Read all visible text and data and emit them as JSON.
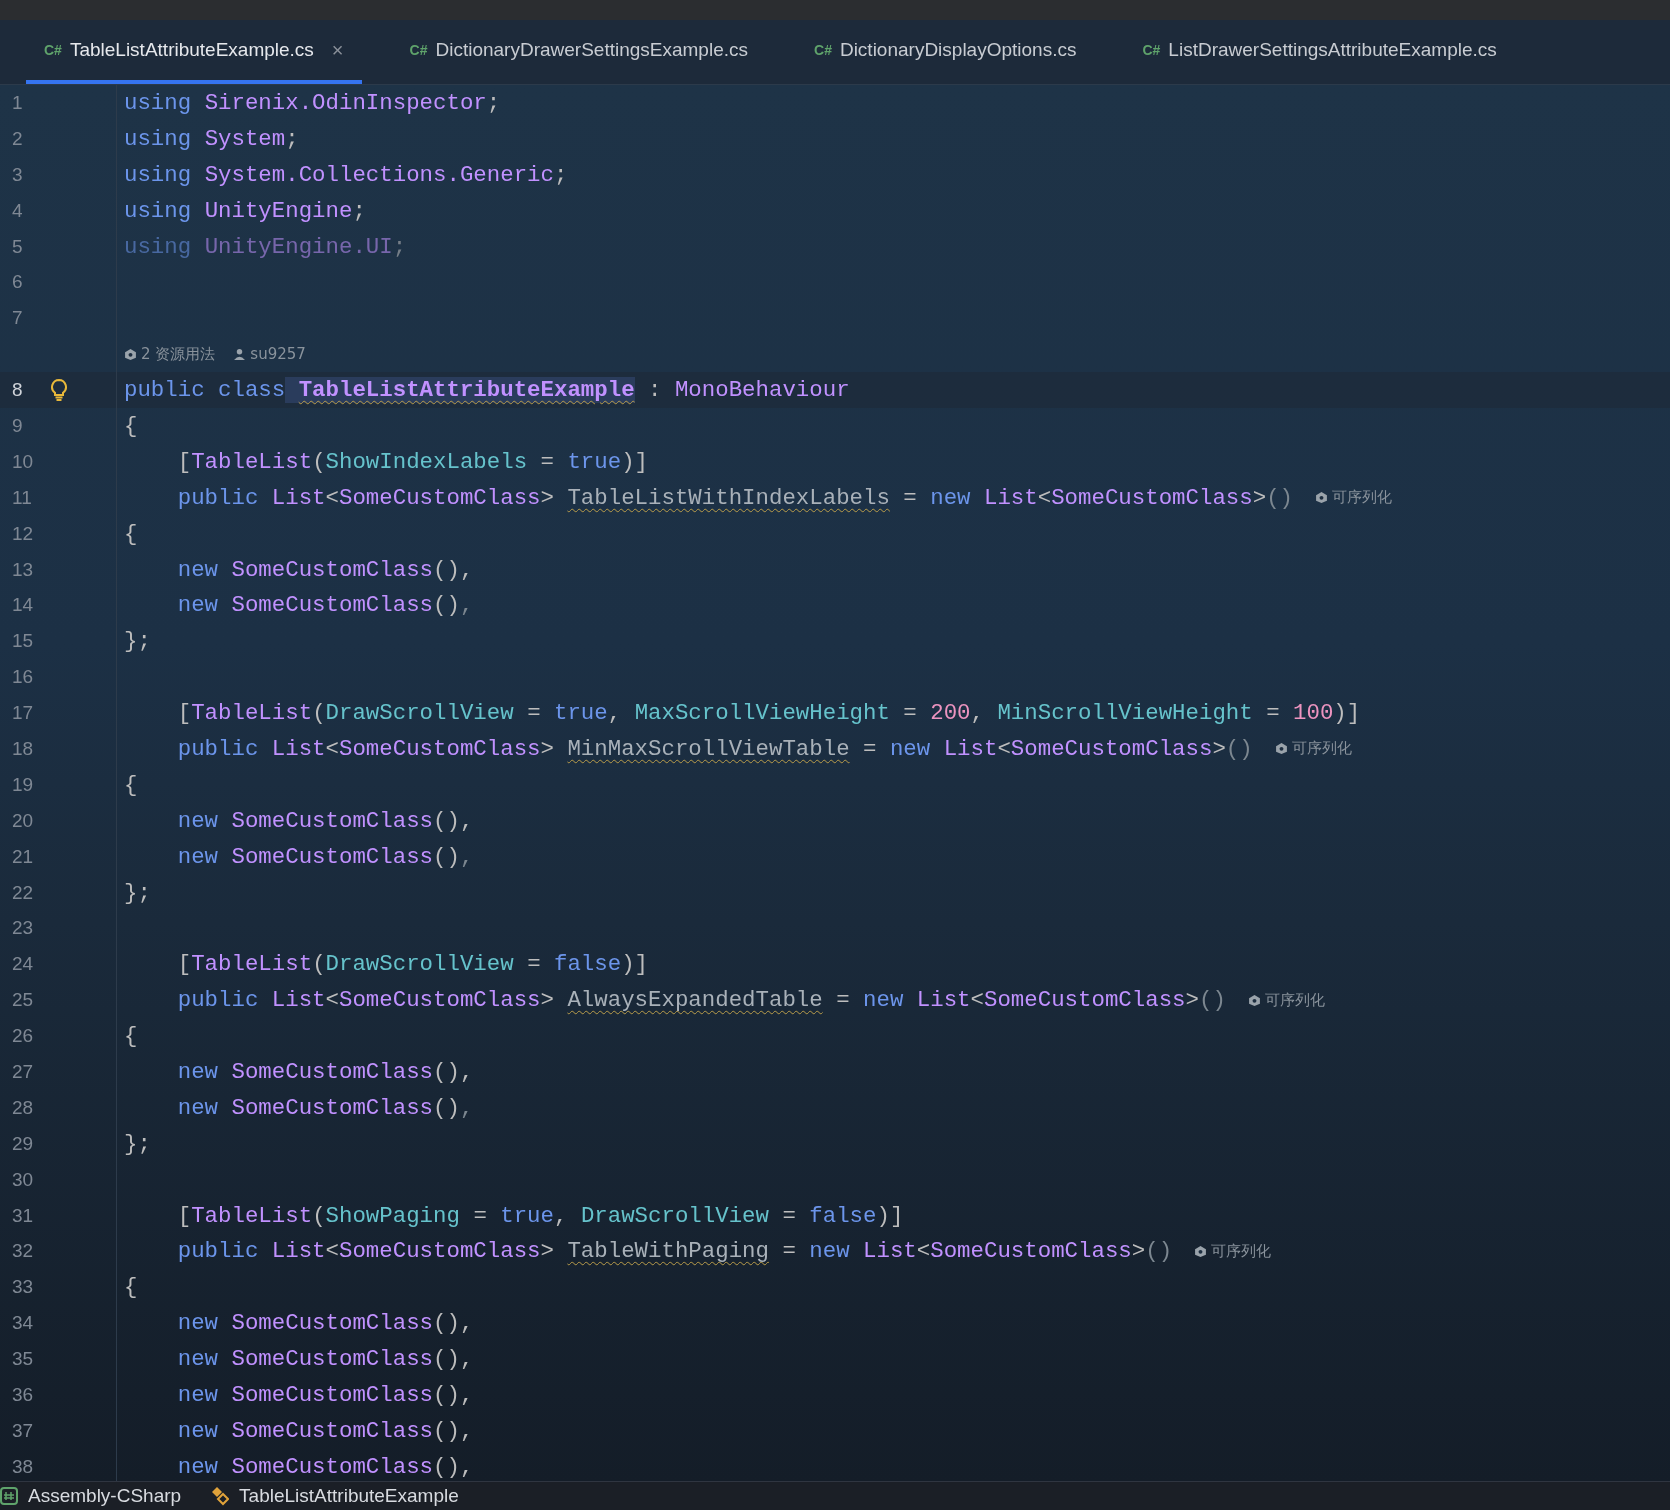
{
  "tabs": [
    {
      "icon": "C#",
      "label": "TableListAttributeExample.cs",
      "selected": true,
      "close": "×"
    },
    {
      "icon": "C#",
      "label": "DictionaryDrawerSettingsExample.cs",
      "selected": false
    },
    {
      "icon": "C#",
      "label": "DictionaryDisplayOptions.cs",
      "selected": false
    },
    {
      "icon": "C#",
      "label": "ListDrawerSettingsAttributeExample.cs",
      "selected": false
    }
  ],
  "lines": [
    {
      "number": "1",
      "current": false,
      "dim": false,
      "indented": false,
      "tokens": [
        {
          "kind": "kw",
          "text": "using",
          "space_before": false
        },
        {
          "kind": "ns",
          "text": "Sirenix.OdinInspector",
          "space_before": true
        },
        {
          "kind": "punct",
          "text": ";",
          "space_before": false
        }
      ]
    },
    {
      "number": "2",
      "current": false,
      "dim": false,
      "indented": false,
      "tokens": [
        {
          "kind": "kw",
          "text": "using",
          "space_before": false
        },
        {
          "kind": "ns",
          "text": "System",
          "space_before": true
        },
        {
          "kind": "punct",
          "text": ";",
          "space_before": false
        }
      ]
    },
    {
      "number": "3",
      "current": false,
      "dim": false,
      "indented": false,
      "tokens": [
        {
          "kind": "kw",
          "text": "using",
          "space_before": false
        },
        {
          "kind": "ns",
          "text": "System.Collections.Generic",
          "space_before": true
        },
        {
          "kind": "punct",
          "text": ";",
          "space_before": false
        }
      ]
    },
    {
      "number": "4",
      "current": false,
      "dim": false,
      "indented": false,
      "tokens": [
        {
          "kind": "kw",
          "text": "using",
          "space_before": false
        },
        {
          "kind": "ns",
          "text": "UnityEngine",
          "space_before": true
        },
        {
          "kind": "punct",
          "text": ";",
          "space_before": false
        }
      ]
    },
    {
      "number": "5",
      "current": false,
      "dim": true,
      "indented": false,
      "tokens": [
        {
          "kind": "kw",
          "text": "using",
          "space_before": false
        },
        {
          "kind": "ns",
          "text": "UnityEngine.UI",
          "space_before": true
        },
        {
          "kind": "punct",
          "text": ";",
          "space_before": false
        }
      ]
    },
    {
      "number": "6",
      "current": false
    },
    {
      "number": "7",
      "current": false
    },
    {
      "number": "8",
      "current": true,
      "dim": false,
      "indented": false,
      "lens": {
        "usages": "2 资源用法",
        "author": "su9257"
      },
      "tokens": [
        {
          "kind": "kw",
          "text": "public",
          "space_before": false
        },
        {
          "kind": "kw",
          "text": "class",
          "space_before": true
        },
        {
          "kind": "decl",
          "text": "TableListAttributeExample",
          "space_before": true
        },
        {
          "kind": "punct",
          "text": ":",
          "space_before": true
        },
        {
          "kind": "type",
          "text": "MonoBehaviour",
          "space_before": true
        }
      ]
    },
    {
      "number": "9",
      "current": false,
      "dim": false,
      "indented": false,
      "tokens": [
        {
          "kind": "punct",
          "text": "{",
          "space_before": false
        }
      ]
    },
    {
      "number": "10",
      "current": false,
      "dim": false,
      "indented": true,
      "tokens": [
        {
          "kind": "punct",
          "text": "[",
          "space_before": false
        },
        {
          "kind": "type",
          "text": "TableList",
          "space_before": false
        },
        {
          "kind": "punct",
          "text": "(",
          "space_before": false
        },
        {
          "kind": "prop",
          "text": "ShowIndexLabels",
          "space_before": false
        },
        {
          "kind": "punct",
          "text": "=",
          "space_before": true
        },
        {
          "kind": "kw",
          "text": "true",
          "space_before": true
        },
        {
          "kind": "punct",
          "text": ")]",
          "space_before": false
        }
      ]
    },
    {
      "number": "11",
      "current": false,
      "dim": false,
      "indented": true,
      "tokens": [
        {
          "kind": "kw",
          "text": "public",
          "space_before": false
        },
        {
          "kind": "type",
          "text": "List",
          "space_before": true
        },
        {
          "kind": "punct",
          "text": "<",
          "space_before": false
        },
        {
          "kind": "type",
          "text": "SomeCustomClass",
          "space_before": false
        },
        {
          "kind": "punct",
          "text": ">",
          "space_before": false
        },
        {
          "kind": "field",
          "text": "TableListWithIndexLabels",
          "space_before": true
        },
        {
          "kind": "punct",
          "text": "=",
          "space_before": true
        },
        {
          "kind": "kw",
          "text": "new",
          "space_before": true
        },
        {
          "kind": "type",
          "text": "List",
          "space_before": true
        },
        {
          "kind": "punct",
          "text": "<",
          "space_before": false
        },
        {
          "kind": "type",
          "text": "SomeCustomClass",
          "space_before": false
        },
        {
          "kind": "punct",
          "text": ">",
          "space_before": false
        },
        {
          "kind": "dim",
          "text": "()",
          "space_before": false
        },
        {
          "kind": "hint",
          "text": "可序列化",
          "space_before": true
        }
      ]
    },
    {
      "number": "12",
      "current": false,
      "dim": false,
      "indented": false,
      "tokens": [
        {
          "kind": "punct",
          "text": "{",
          "space_before": false
        }
      ]
    },
    {
      "number": "13",
      "current": false,
      "dim": false,
      "indented": true,
      "tokens": [
        {
          "kind": "kw",
          "text": "new",
          "space_before": false
        },
        {
          "kind": "type",
          "text": "SomeCustomClass",
          "space_before": true
        },
        {
          "kind": "punct",
          "text": "(),",
          "space_before": false
        }
      ]
    },
    {
      "number": "14",
      "current": false,
      "dim": false,
      "indented": true,
      "tokens": [
        {
          "kind": "kw",
          "text": "new",
          "space_before": false
        },
        {
          "kind": "type",
          "text": "SomeCustomClass",
          "space_before": true
        },
        {
          "kind": "punct",
          "text": "()",
          "space_before": false
        },
        {
          "kind": "dim",
          "text": ",",
          "space_before": false
        }
      ]
    },
    {
      "number": "15",
      "current": false,
      "dim": false,
      "indented": false,
      "tokens": [
        {
          "kind": "punct",
          "text": "};",
          "space_before": false
        }
      ]
    },
    {
      "number": "16",
      "current": false
    },
    {
      "number": "17",
      "current": false,
      "dim": false,
      "indented": true,
      "tokens": [
        {
          "kind": "punct",
          "text": "[",
          "space_before": false
        },
        {
          "kind": "type",
          "text": "TableList",
          "space_before": false
        },
        {
          "kind": "punct",
          "text": "(",
          "space_before": false
        },
        {
          "kind": "prop",
          "text": "DrawScrollView",
          "space_before": false
        },
        {
          "kind": "punct",
          "text": "=",
          "space_before": true
        },
        {
          "kind": "kw",
          "text": "true",
          "space_before": true
        },
        {
          "kind": "punct",
          "text": ",",
          "space_before": false
        },
        {
          "kind": "prop",
          "text": "MaxScrollViewHeight",
          "space_before": true
        },
        {
          "kind": "punct",
          "text": "=",
          "space_before": true
        },
        {
          "kind": "num",
          "text": "200",
          "space_before": true
        },
        {
          "kind": "punct",
          "text": ",",
          "space_before": false
        },
        {
          "kind": "prop",
          "text": "MinScrollViewHeight",
          "space_before": true
        },
        {
          "kind": "punct",
          "text": "=",
          "space_before": true
        },
        {
          "kind": "num",
          "text": "100",
          "space_before": true
        },
        {
          "kind": "punct",
          "text": ")]",
          "space_before": false
        }
      ]
    },
    {
      "number": "18",
      "current": false,
      "dim": false,
      "indented": true,
      "tokens": [
        {
          "kind": "kw",
          "text": "public",
          "space_before": false
        },
        {
          "kind": "type",
          "text": "List",
          "space_before": true
        },
        {
          "kind": "punct",
          "text": "<",
          "space_before": false
        },
        {
          "kind": "type",
          "text": "SomeCustomClass",
          "space_before": false
        },
        {
          "kind": "punct",
          "text": ">",
          "space_before": false
        },
        {
          "kind": "field",
          "text": "MinMaxScrollViewTable",
          "space_before": true
        },
        {
          "kind": "punct",
          "text": "=",
          "space_before": true
        },
        {
          "kind": "kw",
          "text": "new",
          "space_before": true
        },
        {
          "kind": "type",
          "text": "List",
          "space_before": true
        },
        {
          "kind": "punct",
          "text": "<",
          "space_before": false
        },
        {
          "kind": "type",
          "text": "SomeCustomClass",
          "space_before": false
        },
        {
          "kind": "punct",
          "text": ">",
          "space_before": false
        },
        {
          "kind": "dim",
          "text": "()",
          "space_before": false
        },
        {
          "kind": "hint",
          "text": "可序列化",
          "space_before": true
        }
      ]
    },
    {
      "number": "19",
      "current": false,
      "dim": false,
      "indented": false,
      "tokens": [
        {
          "kind": "punct",
          "text": "{",
          "space_before": false
        }
      ]
    },
    {
      "number": "20",
      "current": false,
      "dim": false,
      "indented": true,
      "tokens": [
        {
          "kind": "kw",
          "text": "new",
          "space_before": false
        },
        {
          "kind": "type",
          "text": "SomeCustomClass",
          "space_before": true
        },
        {
          "kind": "punct",
          "text": "(),",
          "space_before": false
        }
      ]
    },
    {
      "number": "21",
      "current": false,
      "dim": false,
      "indented": true,
      "tokens": [
        {
          "kind": "kw",
          "text": "new",
          "space_before": false
        },
        {
          "kind": "type",
          "text": "SomeCustomClass",
          "space_before": true
        },
        {
          "kind": "punct",
          "text": "()",
          "space_before": false
        },
        {
          "kind": "dim",
          "text": ",",
          "space_before": false
        }
      ]
    },
    {
      "number": "22",
      "current": false,
      "dim": false,
      "indented": false,
      "tokens": [
        {
          "kind": "punct",
          "text": "};",
          "space_before": false
        }
      ]
    },
    {
      "number": "23",
      "current": false
    },
    {
      "number": "24",
      "current": false,
      "dim": false,
      "indented": true,
      "tokens": [
        {
          "kind": "punct",
          "text": "[",
          "space_before": false
        },
        {
          "kind": "type",
          "text": "TableList",
          "space_before": false
        },
        {
          "kind": "punct",
          "text": "(",
          "space_before": false
        },
        {
          "kind": "prop",
          "text": "DrawScrollView",
          "space_before": false
        },
        {
          "kind": "punct",
          "text": "=",
          "space_before": true
        },
        {
          "kind": "kw",
          "text": "false",
          "space_before": true
        },
        {
          "kind": "punct",
          "text": ")]",
          "space_before": false
        }
      ]
    },
    {
      "number": "25",
      "current": false,
      "dim": false,
      "indented": true,
      "tokens": [
        {
          "kind": "kw",
          "text": "public",
          "space_before": false
        },
        {
          "kind": "type",
          "text": "List",
          "space_before": true
        },
        {
          "kind": "punct",
          "text": "<",
          "space_before": false
        },
        {
          "kind": "type",
          "text": "SomeCustomClass",
          "space_before": false
        },
        {
          "kind": "punct",
          "text": ">",
          "space_before": false
        },
        {
          "kind": "field",
          "text": "AlwaysExpandedTable",
          "space_before": true
        },
        {
          "kind": "punct",
          "text": "=",
          "space_before": true
        },
        {
          "kind": "kw",
          "text": "new",
          "space_before": true
        },
        {
          "kind": "type",
          "text": "List",
          "space_before": true
        },
        {
          "kind": "punct",
          "text": "<",
          "space_before": false
        },
        {
          "kind": "type",
          "text": "SomeCustomClass",
          "space_before": false
        },
        {
          "kind": "punct",
          "text": ">",
          "space_before": false
        },
        {
          "kind": "dim",
          "text": "()",
          "space_before": false
        },
        {
          "kind": "hint",
          "text": "可序列化",
          "space_before": true
        }
      ]
    },
    {
      "number": "26",
      "current": false,
      "dim": false,
      "indented": false,
      "tokens": [
        {
          "kind": "punct",
          "text": "{",
          "space_before": false
        }
      ]
    },
    {
      "number": "27",
      "current": false,
      "dim": false,
      "indented": true,
      "tokens": [
        {
          "kind": "kw",
          "text": "new",
          "space_before": false
        },
        {
          "kind": "type",
          "text": "SomeCustomClass",
          "space_before": true
        },
        {
          "kind": "punct",
          "text": "(),",
          "space_before": false
        }
      ]
    },
    {
      "number": "28",
      "current": false,
      "dim": false,
      "indented": true,
      "tokens": [
        {
          "kind": "kw",
          "text": "new",
          "space_before": false
        },
        {
          "kind": "type",
          "text": "SomeCustomClass",
          "space_before": true
        },
        {
          "kind": "punct",
          "text": "()",
          "space_before": false
        },
        {
          "kind": "dim",
          "text": ",",
          "space_before": false
        }
      ]
    },
    {
      "number": "29",
      "current": false,
      "dim": false,
      "indented": false,
      "tokens": [
        {
          "kind": "punct",
          "text": "};",
          "space_before": false
        }
      ]
    },
    {
      "number": "30",
      "current": false
    },
    {
      "number": "31",
      "current": false,
      "dim": false,
      "indented": true,
      "tokens": [
        {
          "kind": "punct",
          "text": "[",
          "space_before": false
        },
        {
          "kind": "type",
          "text": "TableList",
          "space_before": false
        },
        {
          "kind": "punct",
          "text": "(",
          "space_before": false
        },
        {
          "kind": "prop",
          "text": "ShowPaging",
          "space_before": false
        },
        {
          "kind": "punct",
          "text": "=",
          "space_before": true
        },
        {
          "kind": "kw",
          "text": "true",
          "space_before": true
        },
        {
          "kind": "punct",
          "text": ",",
          "space_before": false
        },
        {
          "kind": "prop",
          "text": "DrawScrollView",
          "space_before": true
        },
        {
          "kind": "punct",
          "text": "=",
          "space_before": true
        },
        {
          "kind": "kw",
          "text": "false",
          "space_before": true
        },
        {
          "kind": "punct",
          "text": ")]",
          "space_before": false
        }
      ]
    },
    {
      "number": "32",
      "current": false,
      "dim": false,
      "indented": true,
      "tokens": [
        {
          "kind": "kw",
          "text": "public",
          "space_before": false
        },
        {
          "kind": "type",
          "text": "List",
          "space_before": true
        },
        {
          "kind": "punct",
          "text": "<",
          "space_before": false
        },
        {
          "kind": "type",
          "text": "SomeCustomClass",
          "space_before": false
        },
        {
          "kind": "punct",
          "text": ">",
          "space_before": false
        },
        {
          "kind": "field",
          "text": "TableWithPaging",
          "space_before": true
        },
        {
          "kind": "punct",
          "text": "=",
          "space_before": true
        },
        {
          "kind": "kw",
          "text": "new",
          "space_before": true
        },
        {
          "kind": "type",
          "text": "List",
          "space_before": true
        },
        {
          "kind": "punct",
          "text": "<",
          "space_before": false
        },
        {
          "kind": "type",
          "text": "SomeCustomClass",
          "space_before": false
        },
        {
          "kind": "punct",
          "text": ">",
          "space_before": false
        },
        {
          "kind": "dim",
          "text": "()",
          "space_before": false
        },
        {
          "kind": "hint",
          "text": "可序列化",
          "space_before": true
        }
      ]
    },
    {
      "number": "33",
      "current": false,
      "dim": false,
      "indented": false,
      "tokens": [
        {
          "kind": "punct",
          "text": "{",
          "space_before": false
        }
      ]
    },
    {
      "number": "34",
      "current": false,
      "dim": false,
      "indented": true,
      "tokens": [
        {
          "kind": "kw",
          "text": "new",
          "space_before": false
        },
        {
          "kind": "type",
          "text": "SomeCustomClass",
          "space_before": true
        },
        {
          "kind": "punct",
          "text": "(),",
          "space_before": false
        }
      ]
    },
    {
      "number": "35",
      "current": false,
      "dim": false,
      "indented": true,
      "tokens": [
        {
          "kind": "kw",
          "text": "new",
          "space_before": false
        },
        {
          "kind": "type",
          "text": "SomeCustomClass",
          "space_before": true
        },
        {
          "kind": "punct",
          "text": "(),",
          "space_before": false
        }
      ]
    },
    {
      "number": "36",
      "current": false,
      "dim": false,
      "indented": true,
      "tokens": [
        {
          "kind": "kw",
          "text": "new",
          "space_before": false
        },
        {
          "kind": "type",
          "text": "SomeCustomClass",
          "space_before": true
        },
        {
          "kind": "punct",
          "text": "(),",
          "space_before": false
        }
      ]
    },
    {
      "number": "37",
      "current": false,
      "dim": false,
      "indented": true,
      "tokens": [
        {
          "kind": "kw",
          "text": "new",
          "space_before": false
        },
        {
          "kind": "type",
          "text": "SomeCustomClass",
          "space_before": true
        },
        {
          "kind": "punct",
          "text": "(),",
          "space_before": false
        }
      ]
    },
    {
      "number": "38",
      "current": false,
      "dim": false,
      "indented": true,
      "tokens": [
        {
          "kind": "kw",
          "text": "new",
          "space_before": false
        },
        {
          "kind": "type",
          "text": "SomeCustomClass",
          "space_before": true
        },
        {
          "kind": "punct",
          "text": "(),",
          "space_before": false
        }
      ]
    }
  ],
  "status_bar": [
    {
      "kind": "project",
      "text": "Assembly-CSharp"
    },
    {
      "kind": "class",
      "text": "TableListAttributeExample"
    }
  ]
}
